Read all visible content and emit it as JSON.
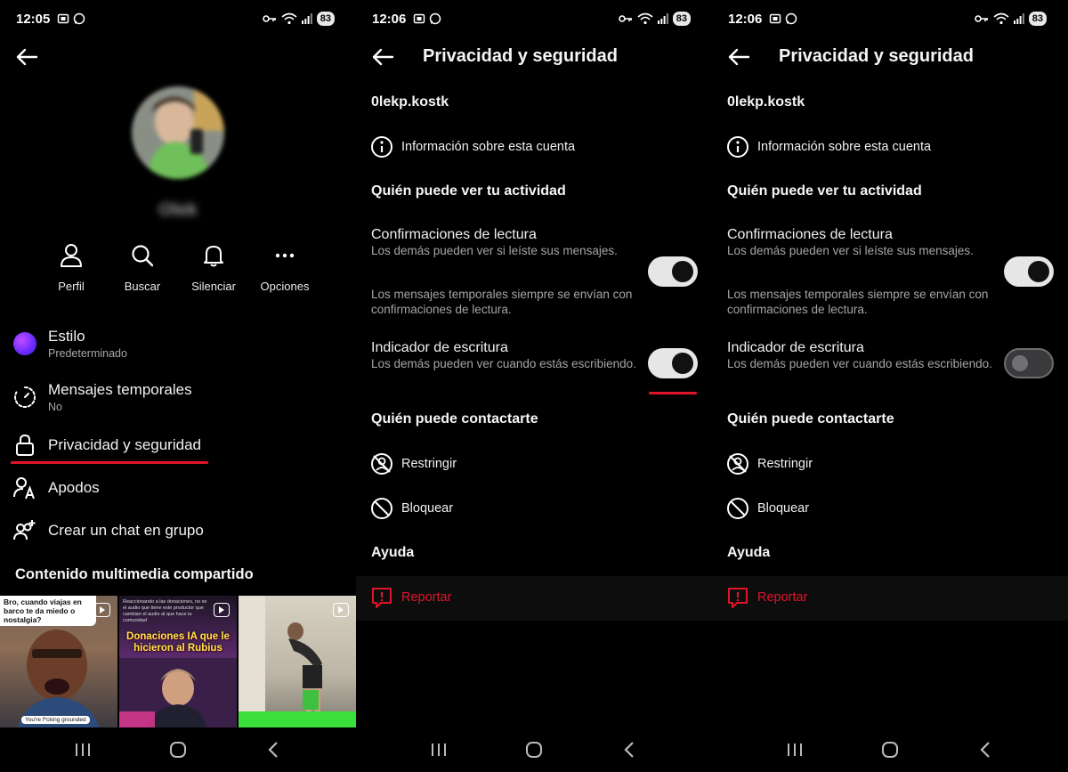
{
  "panel1": {
    "status": {
      "time": "12:05",
      "battery": "83"
    },
    "profile_name": "Olek",
    "actions": [
      {
        "label": "Perfil",
        "icon": "person-icon"
      },
      {
        "label": "Buscar",
        "icon": "search-icon"
      },
      {
        "label": "Silenciar",
        "icon": "bell-icon"
      },
      {
        "label": "Opciones",
        "icon": "more-icon"
      }
    ],
    "menu": {
      "estilo": {
        "label": "Estilo",
        "sub": "Predeterminado"
      },
      "temporales": {
        "label": "Mensajes temporales",
        "sub": "No"
      },
      "privacidad": {
        "label": "Privacidad y seguridad"
      },
      "apodos": {
        "label": "Apodos"
      },
      "grupo": {
        "label": "Crear un chat en grupo"
      }
    },
    "media_header": "Contenido multimedia compartido",
    "thumbs": [
      {
        "caption": "Bro, cuando viajas en barco te da miedo o nostalgia?",
        "bottom": "You're f*cking grounded"
      },
      {
        "caption": "Donaciones IA que le hicieron al Rubius",
        "top": "Reaccionando a las donaciones, no se el audio que tiene este productor que cambian el audio al que hace la comunidad"
      },
      {
        "caption": ""
      }
    ]
  },
  "settings": {
    "title": "Privacidad y seguridad",
    "username": "0lekp.kostk",
    "account_info": "Información sobre esta cuenta",
    "activity_header": "Quién puede ver tu actividad",
    "read_receipts": {
      "title": "Confirmaciones de lectura",
      "desc": "Los demás pueden ver si leíste sus mensajes."
    },
    "temp_note": "Los mensajes temporales siempre se envían con confirmaciones de lectura.",
    "typing": {
      "title": "Indicador de escritura",
      "desc": "Los demás pueden ver cuando estás escribiendo."
    },
    "contact_header": "Quién puede contactarte",
    "restrict": "Restringir",
    "block": "Bloquear",
    "help_header": "Ayuda",
    "report": "Reportar"
  },
  "panel2": {
    "status": {
      "time": "12:06",
      "battery": "83"
    },
    "read_receipts_on": true,
    "typing_on": true
  },
  "panel3": {
    "status": {
      "time": "12:06",
      "battery": "83"
    },
    "read_receipts_on": true,
    "typing_on": false
  },
  "colors": {
    "accent_red": "#e0142b",
    "background": "#000000",
    "toggle_on": "#e6e6e6"
  }
}
